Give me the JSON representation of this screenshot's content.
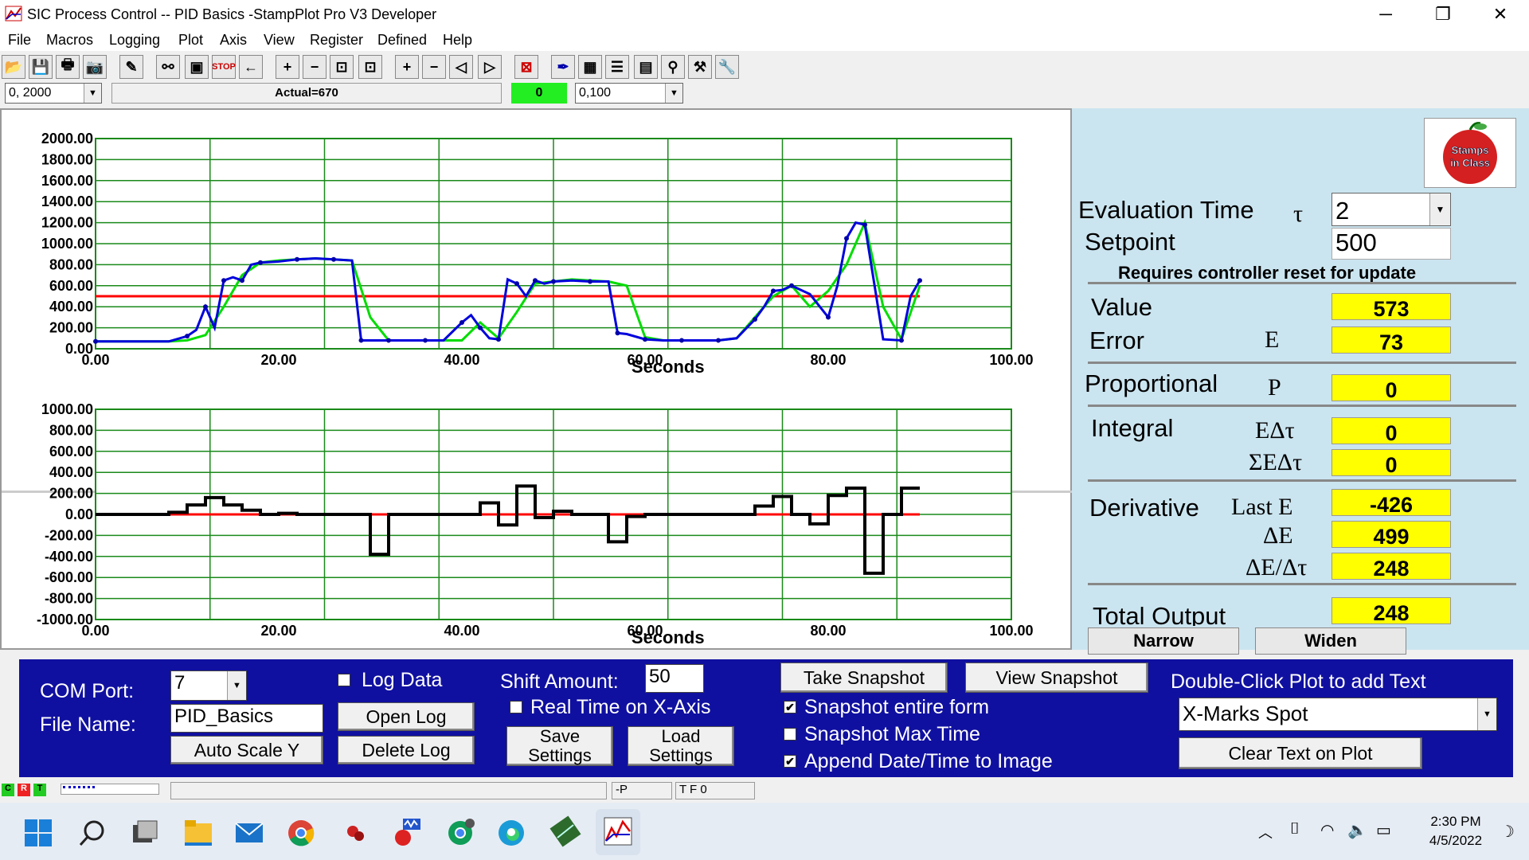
{
  "window": {
    "title": "SIC Process Control -- PID Basics -StampPlot Pro V3 Developer",
    "minimize": "─",
    "maximize": "❐",
    "close": "✕"
  },
  "menu": [
    "File",
    "Macros",
    "Logging",
    "Plot",
    "Axis",
    "View",
    "Register",
    "Defined",
    "Help"
  ],
  "toolbar": {
    "range_combo": "0, 2000",
    "status_text": "Actual=670",
    "counter": "0",
    "range2_combo": "0,100"
  },
  "plot1": {
    "y_ticks": [
      "2000.00",
      "1800.00",
      "1600.00",
      "1400.00",
      "1200.00",
      "1000.00",
      "800.00",
      "600.00",
      "400.00",
      "200.00",
      "0.00"
    ],
    "x_ticks": [
      "0.00",
      "20.00",
      "40.00",
      "60.00",
      "80.00",
      "100.00"
    ],
    "xlabel": "Seconds"
  },
  "plot2": {
    "y_ticks": [
      "1000.00",
      "800.00",
      "600.00",
      "400.00",
      "200.00",
      "0.00",
      "-200.00",
      "-400.00",
      "-600.00",
      "-800.00",
      "-1000.00"
    ],
    "x_ticks": [
      "0.00",
      "20.00",
      "40.00",
      "60.00",
      "80.00",
      "100.00"
    ],
    "xlabel": "Seconds"
  },
  "chart_data": [
    {
      "type": "line",
      "xlabel": "Seconds",
      "ylim": [
        0,
        2000
      ],
      "xlim": [
        0,
        100
      ],
      "grid": true,
      "series": [
        {
          "color": "#ff0000",
          "x": [
            0,
            90
          ],
          "values": [
            500,
            500
          ]
        },
        {
          "color": "#00dd00",
          "x": [
            0,
            8,
            10,
            12,
            14,
            16,
            18,
            20,
            22,
            24,
            26,
            28,
            30,
            32,
            34,
            36,
            38,
            40,
            42,
            44,
            46,
            48,
            50,
            52,
            54,
            56,
            58,
            60,
            62,
            64,
            66,
            68,
            70,
            72,
            74,
            76,
            78,
            80,
            82,
            84,
            86,
            88,
            90
          ],
          "values": [
            70,
            70,
            80,
            130,
            400,
            700,
            820,
            840,
            850,
            860,
            850,
            840,
            300,
            80,
            80,
            80,
            80,
            80,
            250,
            100,
            350,
            620,
            640,
            660,
            650,
            640,
            600,
            110,
            80,
            80,
            80,
            80,
            100,
            300,
            500,
            600,
            400,
            550,
            800,
            1200,
            400,
            90,
            600
          ]
        },
        {
          "color": "#0000dd",
          "x": [
            0,
            8,
            10,
            11,
            12,
            13,
            14,
            15,
            16,
            17,
            18,
            20,
            22,
            24,
            26,
            28,
            29,
            30,
            32,
            34,
            36,
            38,
            40,
            41,
            42,
            43,
            44,
            45,
            46,
            47,
            48,
            49,
            50,
            52,
            54,
            56,
            57,
            58,
            60,
            62,
            64,
            66,
            68,
            70,
            72,
            73,
            74,
            75,
            76,
            78,
            80,
            81,
            82,
            83,
            84,
            86,
            88,
            89,
            90
          ],
          "values": [
            70,
            70,
            120,
            180,
            400,
            200,
            650,
            680,
            650,
            800,
            820,
            830,
            850,
            860,
            850,
            840,
            80,
            80,
            80,
            80,
            80,
            80,
            250,
            320,
            200,
            100,
            90,
            660,
            620,
            500,
            650,
            620,
            640,
            650,
            640,
            640,
            150,
            140,
            90,
            80,
            80,
            80,
            80,
            100,
            280,
            400,
            550,
            560,
            600,
            520,
            300,
            600,
            1050,
            1200,
            1180,
            90,
            80,
            500,
            650
          ]
        }
      ]
    },
    {
      "type": "line",
      "xlabel": "Seconds",
      "ylim": [
        -1000,
        1000
      ],
      "xlim": [
        0,
        100
      ],
      "grid": true,
      "series": [
        {
          "color": "#ff0000",
          "x": [
            0,
            90
          ],
          "values": [
            0,
            0
          ]
        },
        {
          "color": "#000000",
          "step": true,
          "x": [
            0,
            8,
            10,
            12,
            14,
            16,
            18,
            20,
            22,
            24,
            26,
            28,
            30,
            32,
            34,
            36,
            38,
            40,
            42,
            44,
            46,
            48,
            50,
            52,
            54,
            56,
            58,
            60,
            62,
            64,
            66,
            68,
            70,
            72,
            74,
            76,
            78,
            80,
            82,
            84,
            86,
            88,
            90
          ],
          "values": [
            0,
            20,
            90,
            160,
            90,
            40,
            0,
            10,
            0,
            0,
            0,
            0,
            -380,
            0,
            0,
            0,
            0,
            0,
            110,
            -100,
            270,
            -30,
            30,
            0,
            0,
            -260,
            -20,
            0,
            0,
            0,
            0,
            0,
            0,
            80,
            170,
            0,
            -90,
            180,
            250,
            -560,
            0,
            250,
            250
          ]
        }
      ]
    }
  ],
  "right": {
    "eval_time_label": "Evaluation Time",
    "tau": "τ",
    "eval_time_value": "2",
    "setpoint_label": "Setpoint",
    "setpoint_value": "500",
    "reset_note": "Requires controller reset for update",
    "value_label": "Value",
    "value": "573",
    "error_label": "Error",
    "error_sym": "E",
    "error": "73",
    "proportional_label": "Proportional",
    "p_sym": "P",
    "p_value": "0",
    "integral_label": "Integral",
    "ie_sym": "EΔτ",
    "ie_value": "0",
    "sie_sym": "ΣEΔτ",
    "sie_value": "0",
    "derivative_label": "Derivative",
    "laste_sym": "Last E",
    "laste_value": "-426",
    "de_sym": "ΔE",
    "de_value": "499",
    "dedt_sym": "ΔE/Δτ",
    "dedt_value": "248",
    "total_label": "Total Output",
    "total_value": "248",
    "narrow": "Narrow",
    "widen": "Widen",
    "logo_text": "Stamps in Class"
  },
  "bottom": {
    "com_port_label": "COM Port:",
    "com_port_value": "7",
    "file_name_label": "File Name:",
    "file_name_value": "PID_Basics",
    "auto_scale": "Auto Scale Y",
    "log_data": "Log Data",
    "open_log": "Open Log",
    "delete_log": "Delete Log",
    "shift_label": "Shift Amount:",
    "shift_value": "50",
    "realtime": "Real Time on X-Axis",
    "save_settings_1": "Save",
    "save_settings_2": "Settings",
    "load_settings_1": "Load",
    "load_settings_2": "Settings",
    "take_snapshot": "Take Snapshot",
    "view_snapshot": "View Snapshot",
    "snap_entire": "Snapshot entire form",
    "snap_max": "Snapshot Max Time",
    "append_date": "Append Date/Time to Image",
    "dblclick_label": "Double-Click Plot to add Text",
    "text_combo": "X-Marks Spot",
    "clear_text": "Clear Text on Plot"
  },
  "status": {
    "c": "C",
    "r": "R",
    "t": "T",
    "p": "-P",
    "tfo": "T F 0"
  },
  "tray": {
    "time": "2:30 PM",
    "date": "4/5/2022"
  }
}
